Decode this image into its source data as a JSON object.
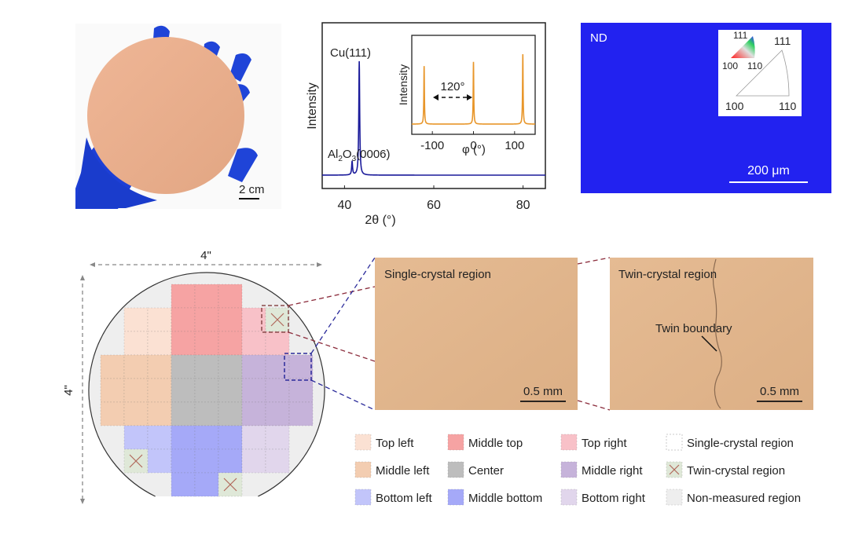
{
  "photo": {
    "scale_bar": "2 cm"
  },
  "chart_data": [
    {
      "type": "line",
      "xlabel": "2θ (°)",
      "ylabel": "Intensity",
      "xlim": [
        35,
        85
      ],
      "xticks": [
        40,
        60,
        80
      ],
      "grid": false,
      "line_color": "#1a1a9a",
      "peaks": [
        {
          "label": "Al2O3(0006)",
          "label_main": "Al",
          "sub1": "2",
          "mid": "O",
          "sub2": "3",
          "rest": "(0006)",
          "x": 41.7,
          "relative_intensity": 0.12
        },
        {
          "label": "Cu(111)",
          "x": 43.3,
          "relative_intensity": 1.0
        }
      ],
      "inset": {
        "type": "line",
        "xlabel": "φ (°)",
        "ylabel": "Intensity",
        "xlim": [
          -150,
          150
        ],
        "xticks": [
          -100,
          0,
          100
        ],
        "line_color": "#e8962a",
        "peaks": [
          {
            "x": -120,
            "relative_intensity": 0.83
          },
          {
            "x": 0,
            "relative_intensity": 0.89
          },
          {
            "x": 120,
            "relative_intensity": 1.0
          }
        ],
        "annotation": "120°"
      }
    }
  ],
  "ebsd": {
    "label": "ND",
    "scale_bar": "200 μm",
    "map_color": "#2222f0",
    "ipf_small": {
      "top": "111",
      "left": "100",
      "right": "110"
    },
    "ipf_large": {
      "top": "111",
      "left": "100",
      "right": "110"
    }
  },
  "wafer": {
    "width_label": "4\"",
    "height_label": "4\"",
    "grid": [
      "...MMM...",
      ".TTMMMRX.",
      ".TTMMMRR.",
      "LLLCCCPPP",
      "LLLCCCPPP",
      "LLLCCCPPP",
      ".BBDDDEE.",
      ".XBDDDEE.",
      "...DDX..."
    ]
  },
  "micrographs": [
    {
      "title": "Single-crystal region",
      "scale_bar": "0.5 mm"
    },
    {
      "title": "Twin-crystal region",
      "scale_bar": "0.5 mm",
      "annotation": "Twin boundary"
    }
  ],
  "legend": [
    {
      "code": "T",
      "label": "Top left",
      "color": "#fbe1d3"
    },
    {
      "code": "M",
      "label": "Middle top",
      "color": "#f6a3a3"
    },
    {
      "code": "R",
      "label": "Top right",
      "color": "#f8c1c8"
    },
    {
      "code": "S",
      "label": "Single-crystal region",
      "color": "#ffffff"
    },
    {
      "code": "L",
      "label": "Middle left",
      "color": "#f3cdb1"
    },
    {
      "code": "C",
      "label": "Center",
      "color": "#bdbdbd"
    },
    {
      "code": "P",
      "label": "Middle right",
      "color": "#c6b3da"
    },
    {
      "code": "X",
      "label": "Twin-crystal region",
      "color": "#dfe8d8"
    },
    {
      "code": "B",
      "label": "Bottom left",
      "color": "#c2c5fa"
    },
    {
      "code": "D",
      "label": "Middle bottom",
      "color": "#a5a9f8"
    },
    {
      "code": "E",
      "label": "Bottom right",
      "color": "#e1d6ec"
    },
    {
      "code": "N",
      "label": "Non-measured region",
      "color": "#eeeeee"
    }
  ]
}
